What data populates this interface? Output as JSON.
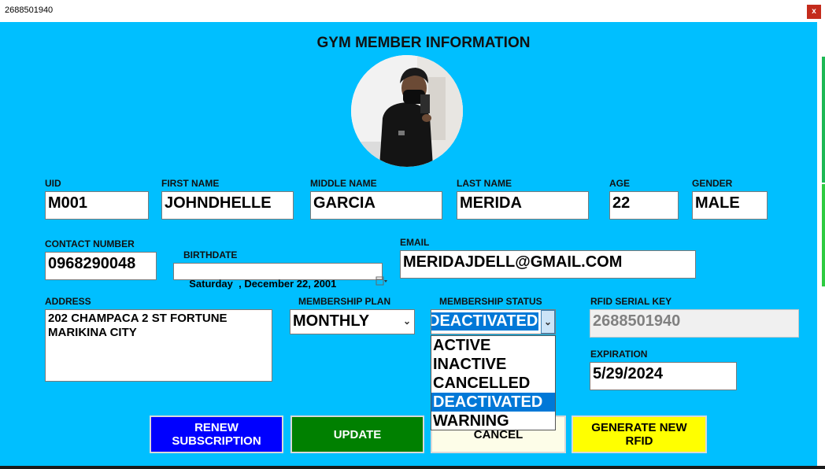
{
  "window": {
    "title": "2688501940",
    "close_label": "x"
  },
  "heading": "GYM MEMBER INFORMATION",
  "labels": {
    "uid": "UID",
    "first_name": "FIRST NAME",
    "middle_name": "MIDDLE NAME",
    "last_name": "LAST NAME",
    "age": "AGE",
    "gender": "GENDER",
    "contact_number": "CONTACT NUMBER",
    "birthdate": "BIRTHDATE",
    "email": "EMAIL",
    "address": "ADDRESS",
    "membership_plan": "MEMBERSHIP PLAN",
    "membership_status": "MEMBERSHIP STATUS",
    "rfid_serial_key": "RFID SERIAL KEY",
    "expiration": "EXPIRATION"
  },
  "values": {
    "uid": "M001",
    "first_name": "JOHNDHELLE",
    "middle_name": "GARCIA",
    "last_name": "MERIDA",
    "age": "22",
    "gender": "MALE",
    "contact_number": "0968290048",
    "birthdate": "Saturday  , December 22, 2001",
    "email": "MERIDAJDELL@GMAIL.COM",
    "address": "202 CHAMPACA 2 ST FORTUNE\nMARIKINA CITY",
    "membership_plan": "MONTHLY",
    "membership_status": "DEACTIVATED",
    "rfid_serial_key": "2688501940",
    "expiration": "5/29/2024"
  },
  "status_options": [
    "ACTIVE",
    "INACTIVE",
    "CANCELLED",
    "DEACTIVATED",
    "WARNING"
  ],
  "buttons": {
    "renew": "RENEW\nSUBSCRIPTION",
    "update": "UPDATE",
    "cancel": "CANCEL",
    "generate": "GENERATE NEW\nRFID"
  },
  "icons": {
    "close": "close-icon",
    "calendar": "calendar-icon",
    "dropdown": "chevron-down-icon"
  },
  "colors": {
    "background": "#00bfff",
    "renew_button": "#0000ff",
    "update_button": "#008000",
    "cancel_button": "#fdfde8",
    "generate_button": "#ffff00",
    "selection": "#0078d7"
  }
}
